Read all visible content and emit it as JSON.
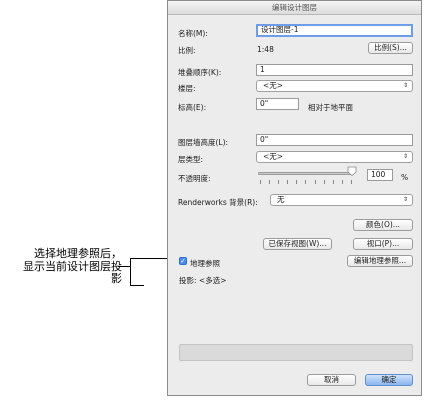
{
  "callout": {
    "line1": "选择地理参照后，",
    "line2": "显示当前设计图层投",
    "line3": "影"
  },
  "dialog": {
    "title": "编辑设计图层",
    "name_label": "名称(M):",
    "name_value": "设计图层-1",
    "scale_label": "比例:",
    "scale_value": "1:48",
    "scale_button": "比例(S)...",
    "stack_order_label": "堆叠顺序(K):",
    "stack_order_value": "1",
    "story_label": "楼层:",
    "story_value": "<无>",
    "elevation_label": "标高(E):",
    "elevation_value": "0\"",
    "elevation_note": "相对于地平面",
    "wall_height_label": "图层墙高度(L):",
    "wall_height_value": "0\"",
    "layer_type_label": "层类型:",
    "layer_type_value": "<无>",
    "opacity_label": "不透明度:",
    "opacity_value": "100",
    "opacity_percent": 100,
    "opacity_unit": "%",
    "renderworks_label": "Renderworks 背景(R):",
    "renderworks_value": "无",
    "color_button": "颜色(O)...",
    "saved_views_button": "已保存视图(W)...",
    "viewport_button": "视口(P)...",
    "georef_label": "地理参照",
    "georef_checked": true,
    "edit_georef_button": "编辑地理参照...",
    "projection_label": "投影: <多选>",
    "cancel_button": "取消",
    "ok_button": "确定"
  }
}
